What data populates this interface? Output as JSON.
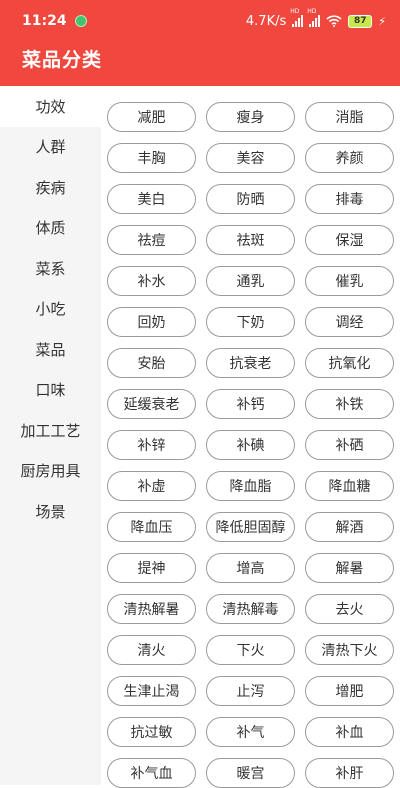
{
  "status_bar": {
    "time": "11:24",
    "network_speed": "4.7K/s",
    "signal_1_label": "HD",
    "signal_2_label": "HD",
    "battery": "87",
    "icons": [
      "notification-icon",
      "signal-icon",
      "wifi-icon",
      "battery-icon",
      "charging-icon"
    ]
  },
  "header": {
    "title": "菜品分类",
    "color": "#f0483e"
  },
  "sidebar": {
    "items": [
      {
        "label": "功效",
        "active": true
      },
      {
        "label": "人群"
      },
      {
        "label": "疾病"
      },
      {
        "label": "体质"
      },
      {
        "label": "菜系"
      },
      {
        "label": "小吃"
      },
      {
        "label": "菜品"
      },
      {
        "label": "口味"
      },
      {
        "label": "加工工艺"
      },
      {
        "label": "厨房用具"
      },
      {
        "label": "场景"
      }
    ]
  },
  "tags": [
    "减肥",
    "瘦身",
    "消脂",
    "丰胸",
    "美容",
    "养颜",
    "美白",
    "防晒",
    "排毒",
    "祛痘",
    "祛斑",
    "保湿",
    "补水",
    "通乳",
    "催乳",
    "回奶",
    "下奶",
    "调经",
    "安胎",
    "抗衰老",
    "抗氧化",
    "延缓衰老",
    "补钙",
    "补铁",
    "补锌",
    "补碘",
    "补硒",
    "补虚",
    "降血脂",
    "降血糖",
    "降血压",
    "降低胆固醇",
    "解酒",
    "提神",
    "增高",
    "解暑",
    "清热解暑",
    "清热解毒",
    "去火",
    "清火",
    "下火",
    "清热下火",
    "生津止渴",
    "止泻",
    "增肥",
    "抗过敏",
    "补气",
    "补血",
    "补气血",
    "暖宫",
    "补肝"
  ]
}
